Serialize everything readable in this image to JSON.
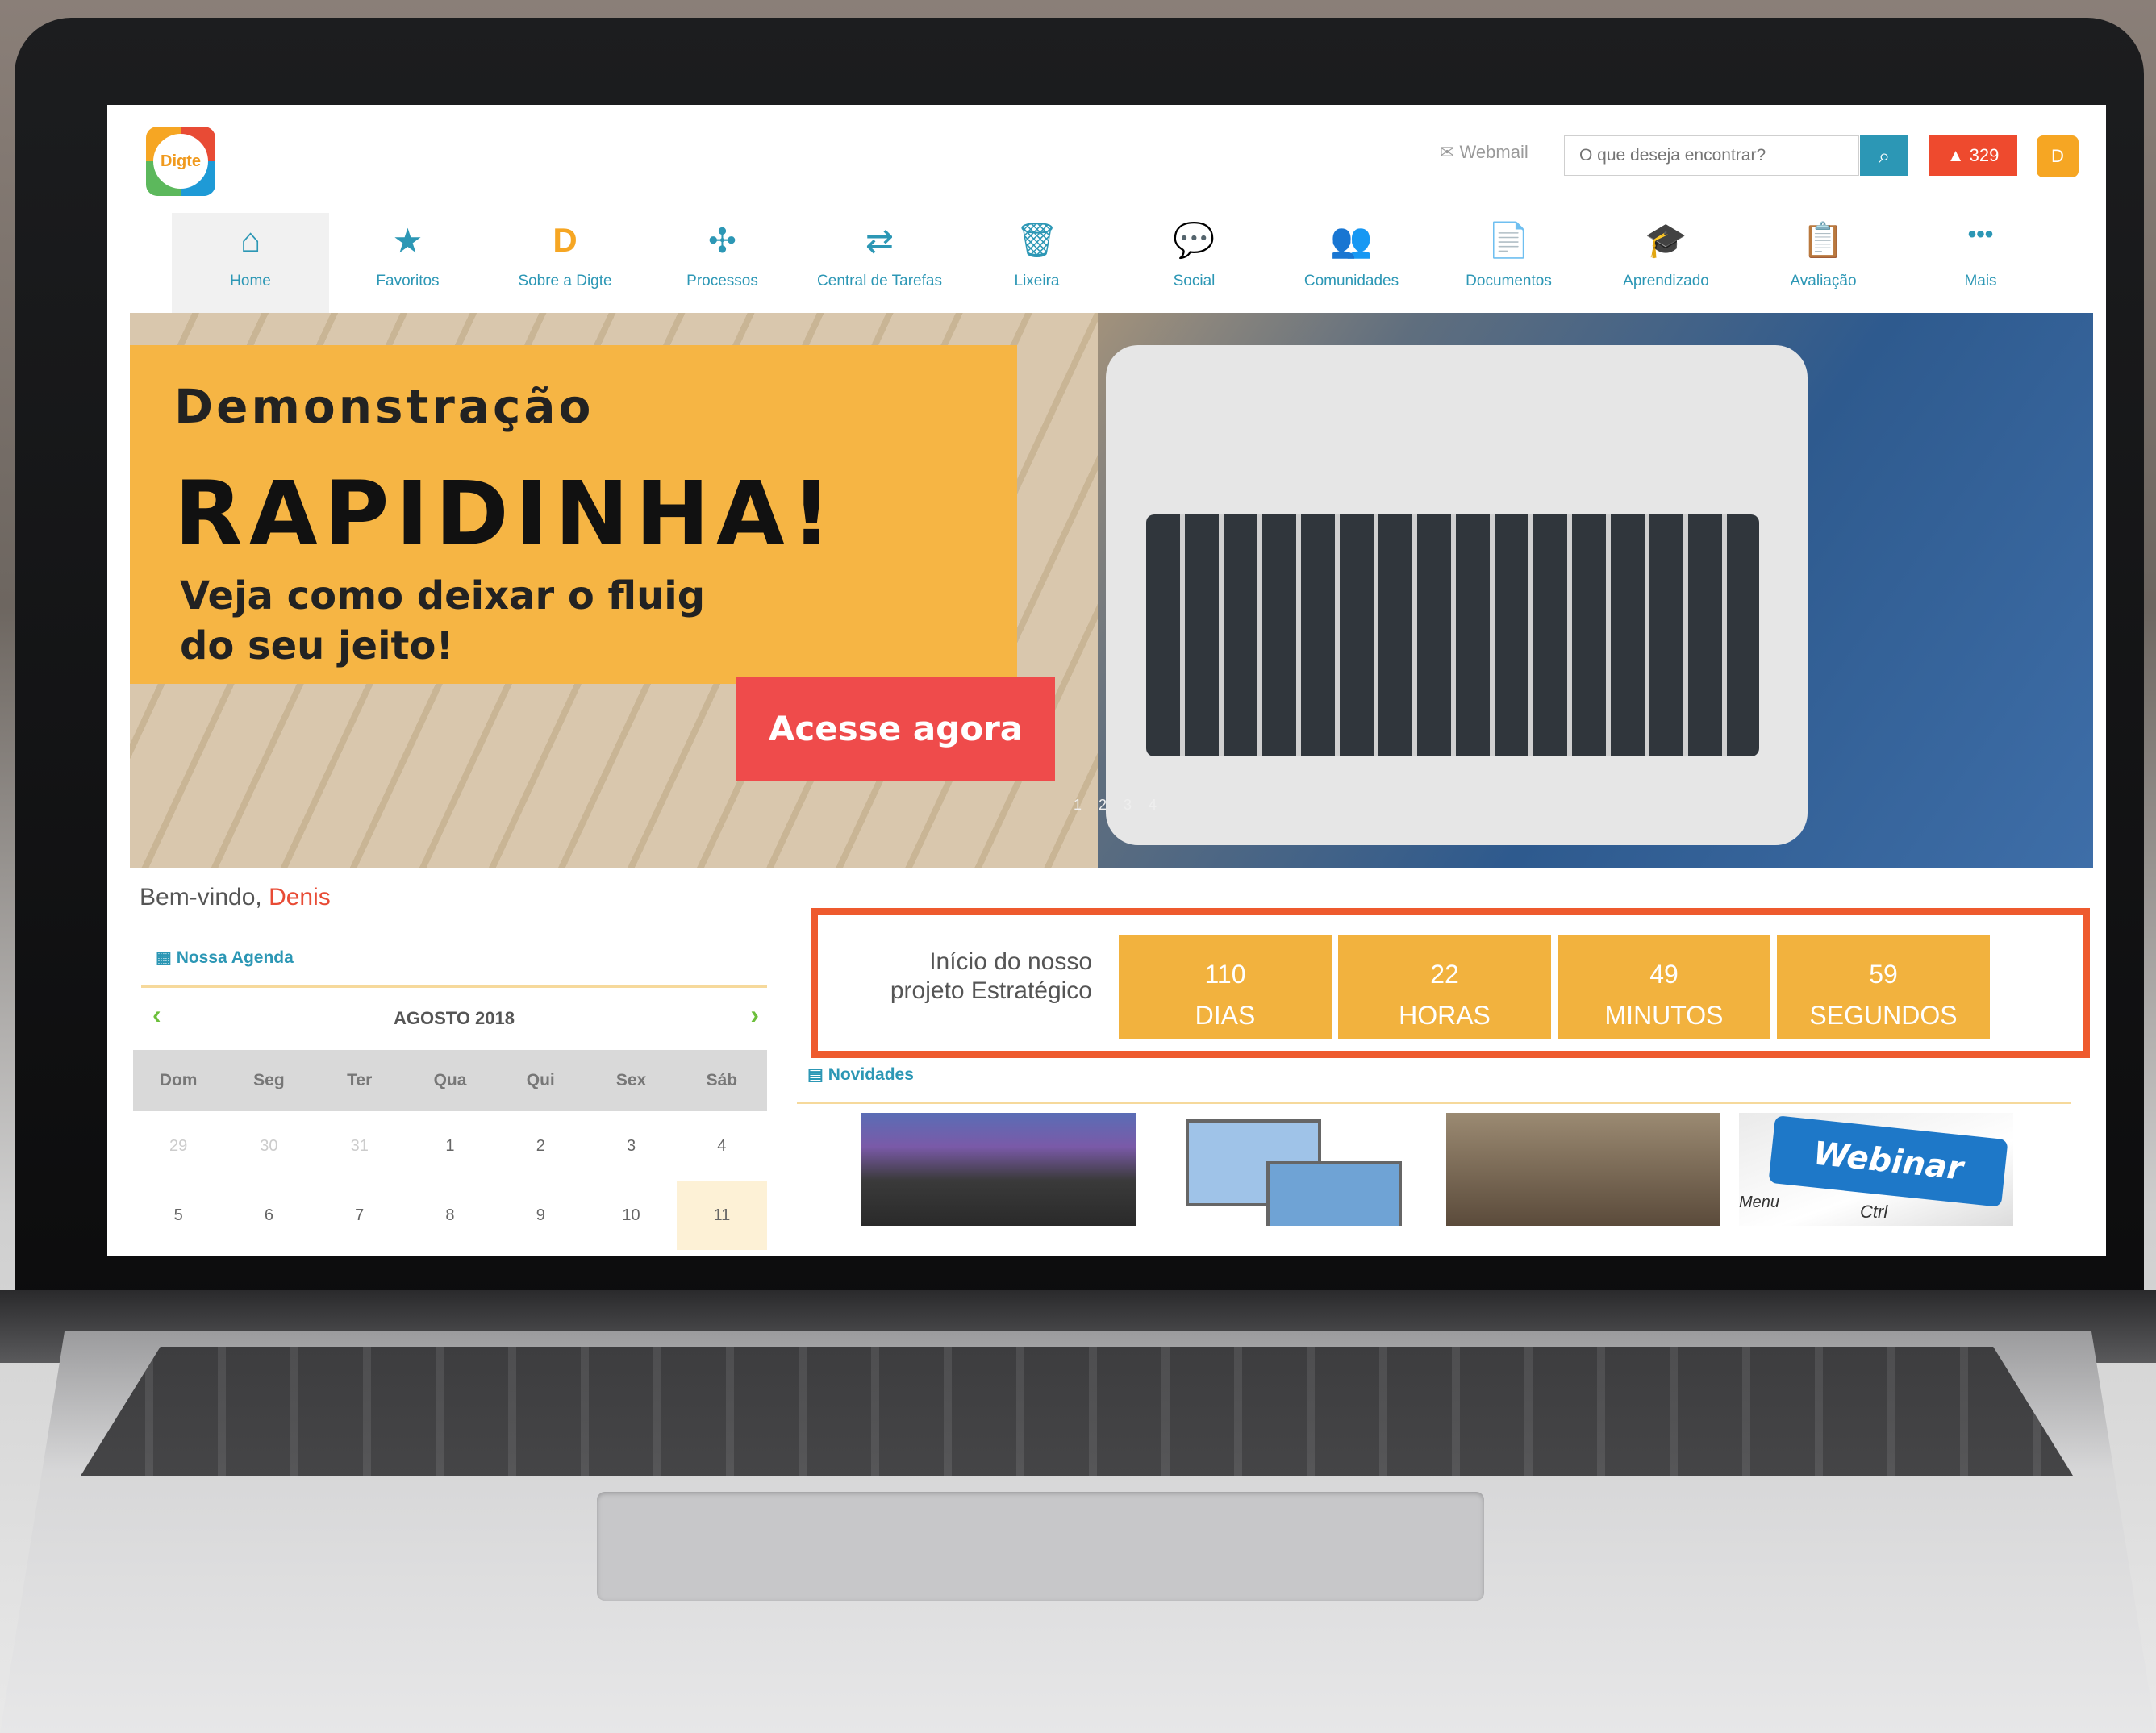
{
  "header": {
    "logo_text": "Digte",
    "webmail": "Webmail",
    "search_placeholder": "O que deseja encontrar?",
    "alert_count": "329",
    "avatar_letter": "D"
  },
  "nav": [
    {
      "label": "Home",
      "icon": "home-icon",
      "glyph": "⌂"
    },
    {
      "label": "Favoritos",
      "icon": "star-icon",
      "glyph": "★"
    },
    {
      "label": "Sobre a Digte",
      "icon": "digte-logo-icon",
      "glyph": "D"
    },
    {
      "label": "Processos",
      "icon": "process-icon",
      "glyph": "✣"
    },
    {
      "label": "Central de Tarefas",
      "icon": "tasks-icon",
      "glyph": "⇄"
    },
    {
      "label": "Lixeira",
      "icon": "trash-icon",
      "glyph": "🗑"
    },
    {
      "label": "Social",
      "icon": "chat-icon",
      "glyph": "💬"
    },
    {
      "label": "Comunidades",
      "icon": "community-icon",
      "glyph": "👥"
    },
    {
      "label": "Documentos",
      "icon": "documents-icon",
      "glyph": "📄"
    },
    {
      "label": "Aprendizado",
      "icon": "graduation-icon",
      "glyph": "🎓"
    },
    {
      "label": "Avaliação",
      "icon": "evaluation-icon",
      "glyph": "📋"
    },
    {
      "label": "Mais",
      "icon": "more-icon",
      "glyph": "•••"
    }
  ],
  "banner": {
    "heading": "Demonstração",
    "title": "RAPIDINHA!",
    "subtitle": "Veja como deixar o fluig do seu jeito!",
    "cta": "Acesse agora",
    "pager": "1 2 3 4"
  },
  "welcome": {
    "prefix": "Bem-vindo, ",
    "name": "Denis"
  },
  "agenda": {
    "title": "Nossa Agenda",
    "month": "AGOSTO 2018",
    "weekdays": [
      "Dom",
      "Seg",
      "Ter",
      "Qua",
      "Qui",
      "Sex",
      "Sáb"
    ],
    "row1": [
      "29",
      "30",
      "31",
      "1",
      "2",
      "3",
      "4"
    ],
    "row2": [
      "5",
      "6",
      "7",
      "8",
      "9",
      "10",
      "11"
    ]
  },
  "countdown": {
    "label": "Início do nosso projeto Estratégico",
    "days": "110",
    "days_unit": "DIAS",
    "hours": "22",
    "hours_unit": "HORAS",
    "minutes": "49",
    "minutes_unit": "MINUTOS",
    "seconds": "59",
    "seconds_unit": "SEGUNDOS"
  },
  "news": {
    "title": "Novidades",
    "webinar_key": "Webinar",
    "key_menu": "Menu",
    "key_ctrl": "Ctrl"
  },
  "colors": {
    "accent": "#2c97b5",
    "alert": "#ee4a2e",
    "countdown": "#f2b23e",
    "highlight_border": "#ee5a2e"
  }
}
